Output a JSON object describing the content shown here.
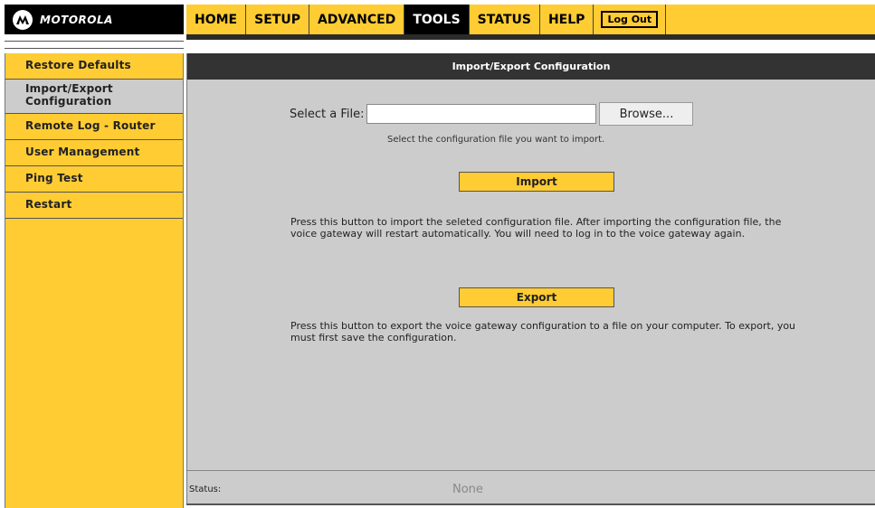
{
  "brand": {
    "logo_text": "MOTOROLA",
    "logo_icon": "motorola-batwing-icon"
  },
  "nav": {
    "items": [
      "HOME",
      "SETUP",
      "ADVANCED",
      "TOOLS",
      "STATUS",
      "HELP"
    ],
    "active": "TOOLS",
    "logout_label": "Log Out"
  },
  "sidebar": {
    "items": [
      {
        "label": "Restore Defaults",
        "active": false
      },
      {
        "label": "Import/Export Configuration",
        "active": true
      },
      {
        "label": "Remote Log - Router",
        "active": false
      },
      {
        "label": "User Management",
        "active": false
      },
      {
        "label": "Ping Test",
        "active": false
      },
      {
        "label": "Restart",
        "active": false
      }
    ]
  },
  "main": {
    "title": "Import/Export Configuration",
    "file_label": "Select a File:",
    "file_value": "",
    "browse_label": "Browse...",
    "file_hint": "Select the configuration file you want to import.",
    "import_label": "Import",
    "import_desc": "Press this button to import the seleted configuration file. After importing the configuration file, the voice gateway will restart automatically. You will need to log in to the voice gateway again.",
    "export_label": "Export",
    "export_desc": "Press this button to export the voice gateway configuration to a file on your computer. To export, you must first save the configuration."
  },
  "status": {
    "label": "Status:",
    "value": "None"
  },
  "colors": {
    "accent": "#ffcc33",
    "header": "#000000",
    "panel": "#cccccc",
    "title_bar": "#333333"
  }
}
